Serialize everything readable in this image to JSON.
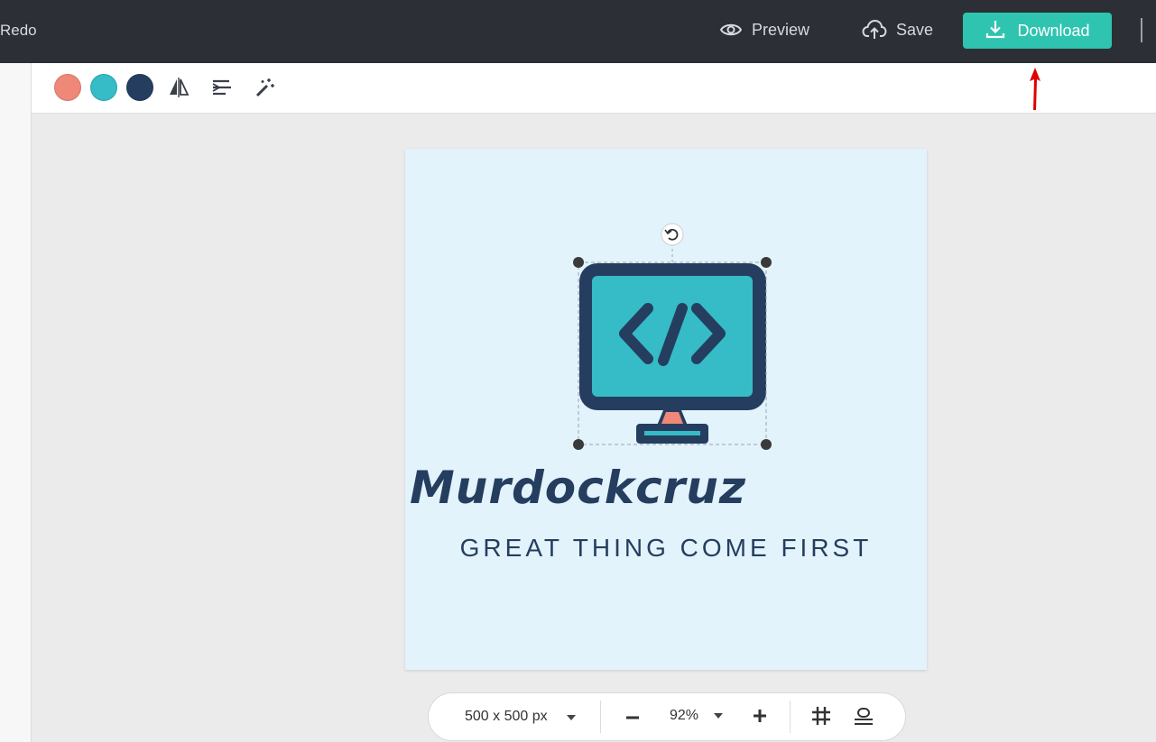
{
  "topbar": {
    "redo_label": "Redo",
    "preview_label": "Preview",
    "save_label": "Save",
    "download_label": "Download"
  },
  "icons": {
    "preview": "eye-icon",
    "save": "cloud-upload-icon",
    "download": "download-icon",
    "flip": "flip-horizontal-icon",
    "align": "text-align-icon",
    "effects": "magic-wand-icon",
    "grid": "grid-icon",
    "baseline": "align-bottom-icon"
  },
  "colors": {
    "topbar_bg": "#2c3036",
    "accent": "#2ec4b0",
    "canvas_bg": "#e2f3fc",
    "swatches": [
      "#ef8878",
      "#35bcc6",
      "#253e5f"
    ]
  },
  "canvas": {
    "brand_name": "Murdockcruz",
    "tagline": "GREAT THING COME FIRST"
  },
  "zoombar": {
    "size_label": "500 x 500 px",
    "zoom_label": "92%",
    "zoom_out": "−",
    "zoom_in": "+"
  }
}
